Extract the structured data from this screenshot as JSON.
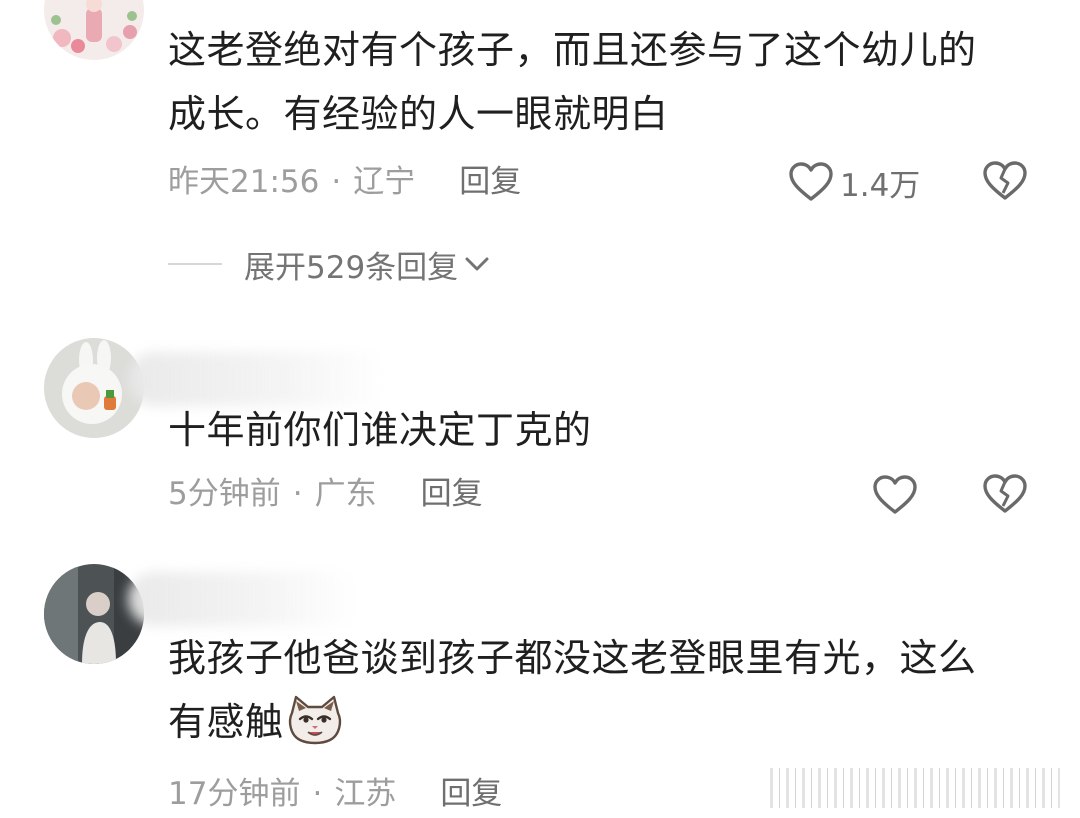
{
  "comments": [
    {
      "text_line1": "这老登绝对有个孩子，而且还参与了这个幼儿的",
      "text_line2": "成长。有经验的人一眼就明白",
      "time": "昨天21:56",
      "separator": "·",
      "location": "辽宁",
      "reply": "回复",
      "likes": "1.4万",
      "expand_replies": "展开529条回复"
    },
    {
      "text": "十年前你们谁决定丁克的",
      "time": "5分钟前",
      "separator": "·",
      "location": "广东",
      "reply": "回复"
    },
    {
      "text_line1": "我孩子他爸谈到孩子都没这老登眼里有光，这么",
      "text_line2": "有感触",
      "time": "17分钟前",
      "separator": "·",
      "location": "江苏",
      "reply": "回复"
    }
  ],
  "icons": {
    "like": "heart-outline-icon",
    "dislike": "broken-heart-icon",
    "expand": "chevron-down-icon",
    "emoji": "cat-emoji-icon"
  },
  "colors": {
    "text": "#1f1f1f",
    "meta": "#9d9d9d",
    "reply": "#6f6f6f",
    "icon": "#6a6a6a"
  }
}
